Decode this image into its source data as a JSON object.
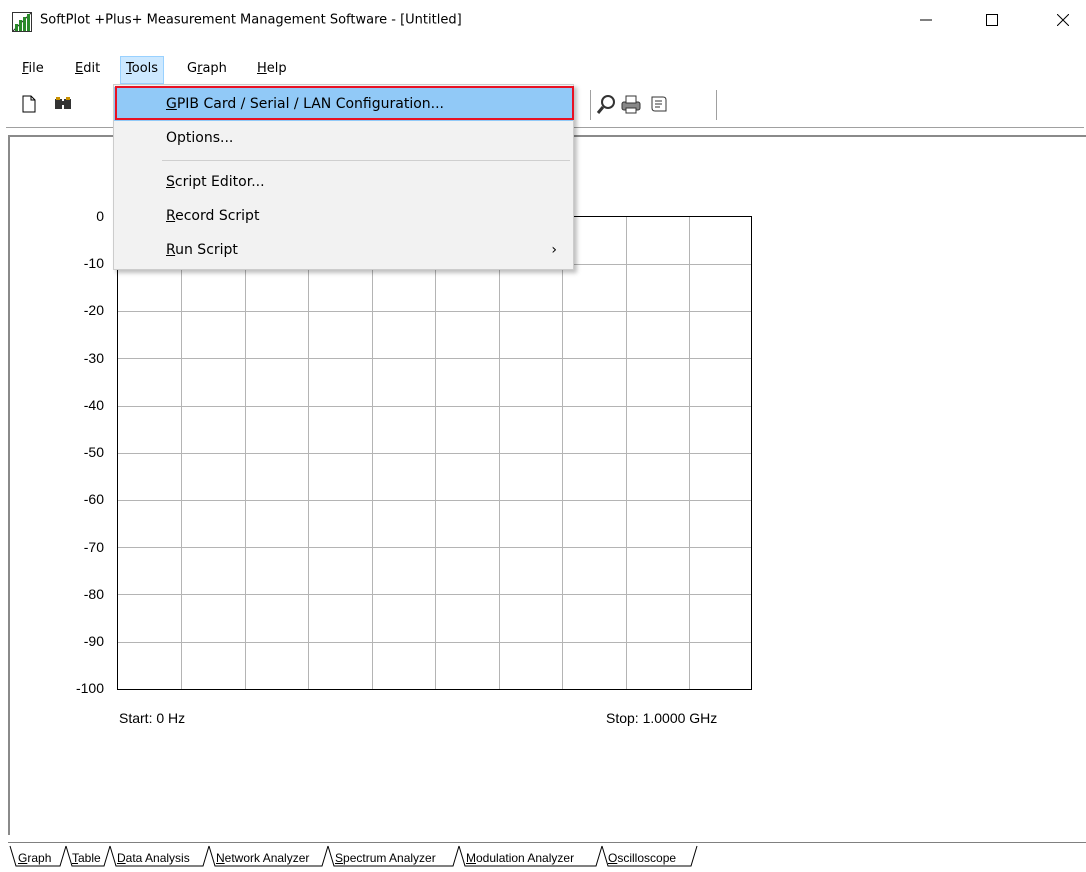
{
  "window": {
    "title": "SoftPlot +Plus+ Measurement Management Software - [Untitled]",
    "minimize_glyph": "—",
    "maximize_glyph": "☐",
    "close_glyph": "✕"
  },
  "menubar": {
    "items": [
      {
        "label": "File",
        "accel": "F",
        "rest": "ile"
      },
      {
        "label": "Edit",
        "accel": "E",
        "rest": "dit"
      },
      {
        "label": "Tools",
        "accel": "T",
        "rest": "ools"
      },
      {
        "label": "Graph",
        "pre": "G",
        "accel": "r",
        "rest": "aph"
      },
      {
        "label": "Help",
        "accel": "H",
        "rest": "elp"
      }
    ]
  },
  "tools_menu": {
    "items": [
      {
        "label": "GPIB Card / Serial / LAN Configuration...",
        "accel": "G",
        "rest": "PIB Card / Serial / LAN Configuration...",
        "highlighted": true
      },
      {
        "label": "Options...",
        "accel": "",
        "rest": "Options..."
      },
      {
        "label": "Script Editor...",
        "accel": "S",
        "rest": "cript Editor..."
      },
      {
        "label": "Record Script",
        "accel": "R",
        "rest": "ecord Script"
      },
      {
        "label": "Run Script",
        "accel": "R",
        "rest": "un Script",
        "submenu_glyph": "›"
      }
    ]
  },
  "graph": {
    "y_ticks": [
      "0",
      "-10",
      "-20",
      "-30",
      "-40",
      "-50",
      "-60",
      "-70",
      "-80",
      "-90",
      "-100"
    ],
    "start_label": "Start: 0 Hz",
    "stop_label": "Stop: 1.0000 GHz"
  },
  "tabs": {
    "items": [
      {
        "label": "Graph",
        "accel": "G",
        "rest": "raph"
      },
      {
        "label": "Table",
        "accel": "T",
        "rest": "able"
      },
      {
        "label": "Data Analysis",
        "accel": "D",
        "rest": "ata Analysis"
      },
      {
        "label": "Network Analyzer",
        "accel": "N",
        "rest": "etwork Analyzer"
      },
      {
        "label": "Spectrum Analyzer",
        "accel": "S",
        "rest": "pectrum Analyzer"
      },
      {
        "label": "Modulation Analyzer",
        "accel": "M",
        "rest": "odulation Analyzer"
      },
      {
        "label": "Oscilloscope",
        "accel": "O",
        "rest": "scilloscope"
      }
    ]
  },
  "colors": {
    "menu_highlight": "#91c9f7",
    "highlight_outline": "#e81123",
    "active_menu_bg": "#cce8ff"
  }
}
